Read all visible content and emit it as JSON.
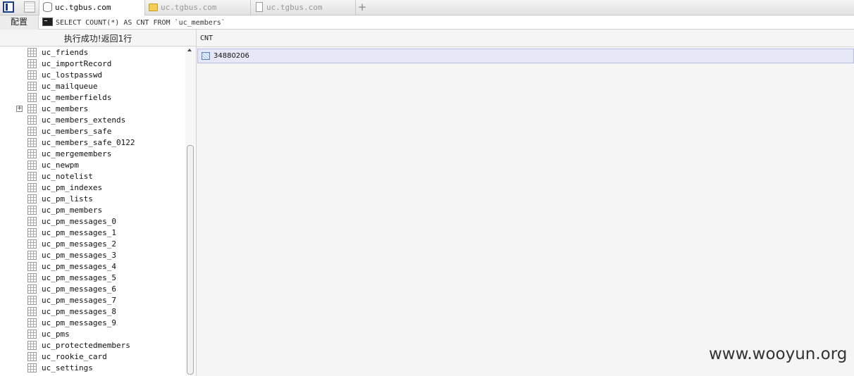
{
  "tabs": [
    {
      "label": "uc.tgbus.com",
      "icon": "database-icon",
      "active": true
    },
    {
      "label": "uc.tgbus.com",
      "icon": "folder-icon",
      "active": false
    },
    {
      "label": "uc.tgbus.com",
      "icon": "document-icon",
      "active": false
    }
  ],
  "toolbar": {
    "add_tab_label": "+",
    "config_label": "配置",
    "query_text": "SELECT COUNT(*) AS CNT FROM `uc_members`"
  },
  "status": {
    "message": "执行成功!返回1行"
  },
  "tree": {
    "items": [
      {
        "label": "uc_friends"
      },
      {
        "label": "uc_importRecord"
      },
      {
        "label": "uc_lostpasswd"
      },
      {
        "label": "uc_mailqueue"
      },
      {
        "label": "uc_memberfields"
      },
      {
        "label": "uc_members",
        "expandable": true,
        "expander": "+"
      },
      {
        "label": "uc_members_extends"
      },
      {
        "label": "uc_members_safe"
      },
      {
        "label": "uc_members_safe_0122"
      },
      {
        "label": "uc_mergemembers"
      },
      {
        "label": "uc_newpm"
      },
      {
        "label": "uc_notelist"
      },
      {
        "label": "uc_pm_indexes"
      },
      {
        "label": "uc_pm_lists"
      },
      {
        "label": "uc_pm_members"
      },
      {
        "label": "uc_pm_messages_0"
      },
      {
        "label": "uc_pm_messages_1"
      },
      {
        "label": "uc_pm_messages_2"
      },
      {
        "label": "uc_pm_messages_3"
      },
      {
        "label": "uc_pm_messages_4"
      },
      {
        "label": "uc_pm_messages_5"
      },
      {
        "label": "uc_pm_messages_6"
      },
      {
        "label": "uc_pm_messages_7"
      },
      {
        "label": "uc_pm_messages_8"
      },
      {
        "label": "uc_pm_messages_9"
      },
      {
        "label": "uc_pms"
      },
      {
        "label": "uc_protectedmembers"
      },
      {
        "label": "uc_rookie_card"
      },
      {
        "label": "uc_settings"
      }
    ]
  },
  "results": {
    "columns": [
      "CNT"
    ],
    "rows": [
      [
        "34880206"
      ]
    ]
  },
  "watermark": "www.wooyun.org",
  "colors": {
    "selected_row": "#e6e7f7",
    "accent": "#1c3f86"
  }
}
